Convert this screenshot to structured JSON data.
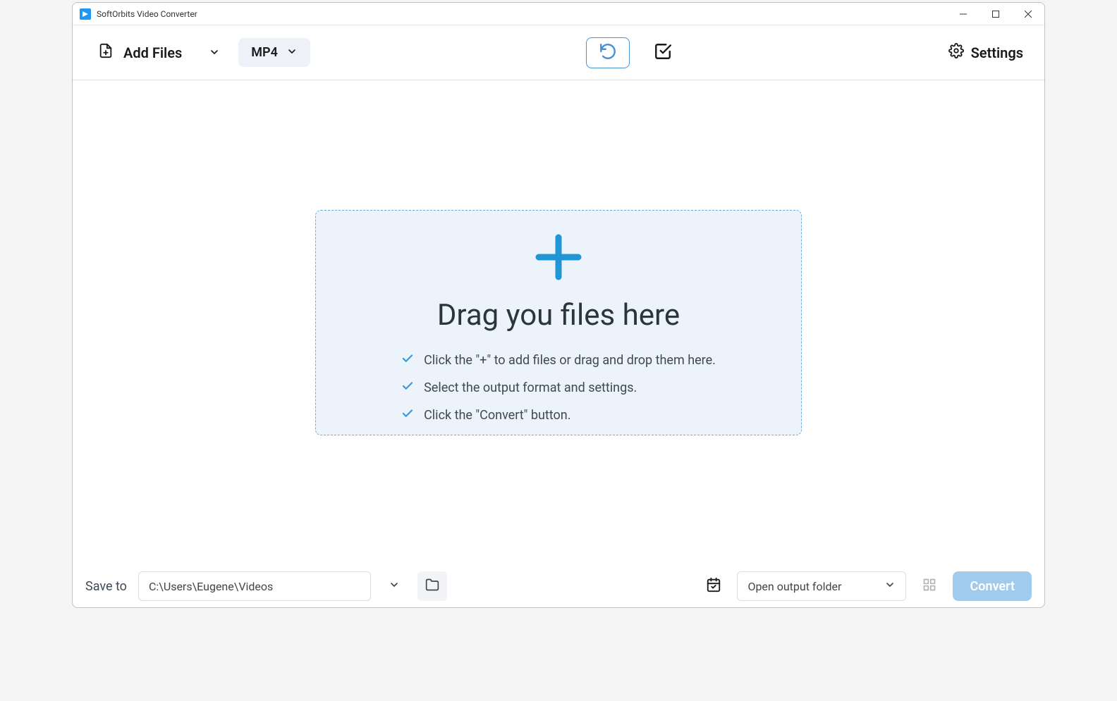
{
  "window": {
    "title": "SoftOrbits Video Converter"
  },
  "toolbar": {
    "add_files_label": "Add Files",
    "format_label": "MP4",
    "settings_label": "Settings"
  },
  "drop_zone": {
    "title": "Drag you files here",
    "instructions": [
      "Click the \"+\" to add files or drag and drop them here.",
      "Select the output format and settings.",
      "Click the \"Convert\" button."
    ]
  },
  "bottom": {
    "save_label": "Save to",
    "path_value": "C:\\Users\\Eugene\\Videos",
    "output_select": "Open output folder",
    "convert_label": "Convert"
  }
}
